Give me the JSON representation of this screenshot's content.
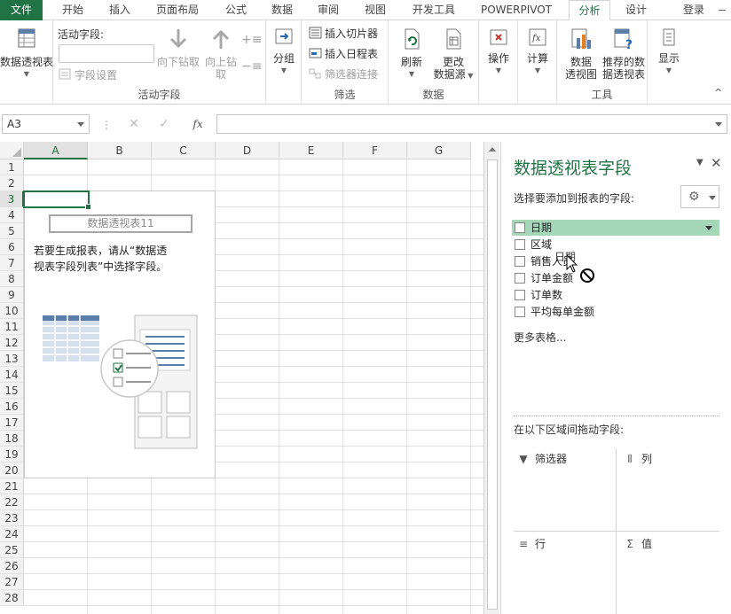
{
  "tabs": [
    {
      "label": "文件"
    },
    {
      "label": "开始"
    },
    {
      "label": "插入"
    },
    {
      "label": "页面布局"
    },
    {
      "label": "公式"
    },
    {
      "label": "数据"
    },
    {
      "label": "审阅"
    },
    {
      "label": "视图"
    },
    {
      "label": "开发工具"
    },
    {
      "label": "POWERPIVOT"
    },
    {
      "label": "分析"
    },
    {
      "label": "设计"
    }
  ],
  "login_label": "登录",
  "ribbon": {
    "pivot_btn": "数据透视表",
    "active_field": {
      "label": "活动字段:",
      "value": "",
      "settings": "字段设置",
      "drill_down": "向下钻取",
      "drill_up_1": "向上钻",
      "drill_up_2": "取",
      "group_label": "活动字段"
    },
    "group_btn": "分组",
    "filter": {
      "slicer": "插入切片器",
      "timeline": "插入日程表",
      "connections": "筛选器连接",
      "group_label": "筛选"
    },
    "data": {
      "refresh": "刷新",
      "change_1": "更改",
      "change_2": "数据源",
      "group_label": "数据"
    },
    "actions": "操作",
    "calc": "计算",
    "tools": {
      "chart_1": "数据",
      "chart_2": "透视图",
      "recommend_1": "推荐的数",
      "recommend_2": "据透视表",
      "group_label": "工具"
    },
    "show": "显示"
  },
  "formula_bar": {
    "name_box": "A3",
    "fx": "fx",
    "formula": ""
  },
  "grid": {
    "columns": [
      "A",
      "B",
      "C",
      "D",
      "E",
      "F",
      "G"
    ],
    "rows": [
      "1",
      "2",
      "3",
      "4",
      "5",
      "6",
      "7",
      "8",
      "9",
      "10",
      "11",
      "12",
      "13",
      "14",
      "15",
      "16",
      "17",
      "18",
      "19",
      "20",
      "21",
      "22",
      "23",
      "24",
      "25",
      "26",
      "27",
      "28"
    ],
    "selected_column": "A",
    "selected_row": "3"
  },
  "pivot_placeholder": {
    "title": "数据透视表11",
    "line1": "若要生成报表，请从“数据透",
    "line2": "视表字段列表”中选择字段。"
  },
  "field_pane": {
    "title": "数据透视表字段",
    "subtitle": "选择要添加到报表的字段:",
    "fields": [
      {
        "label": "日期"
      },
      {
        "label": "区域"
      },
      {
        "label": "销售人员"
      },
      {
        "label": "订单金额"
      },
      {
        "label": "订单数"
      },
      {
        "label": "平均每单金额"
      }
    ],
    "more_tables": "更多表格...",
    "drag_label": "在以下区域间拖动字段:",
    "areas": {
      "filters": "筛选器",
      "columns": "列",
      "rows": "行",
      "values": "值"
    },
    "drag_ghost": "日期"
  },
  "colors": {
    "brand_green": "#217346",
    "highlight": "#a5d6b8",
    "pivot_icon_blue": "#5b7fa8"
  }
}
